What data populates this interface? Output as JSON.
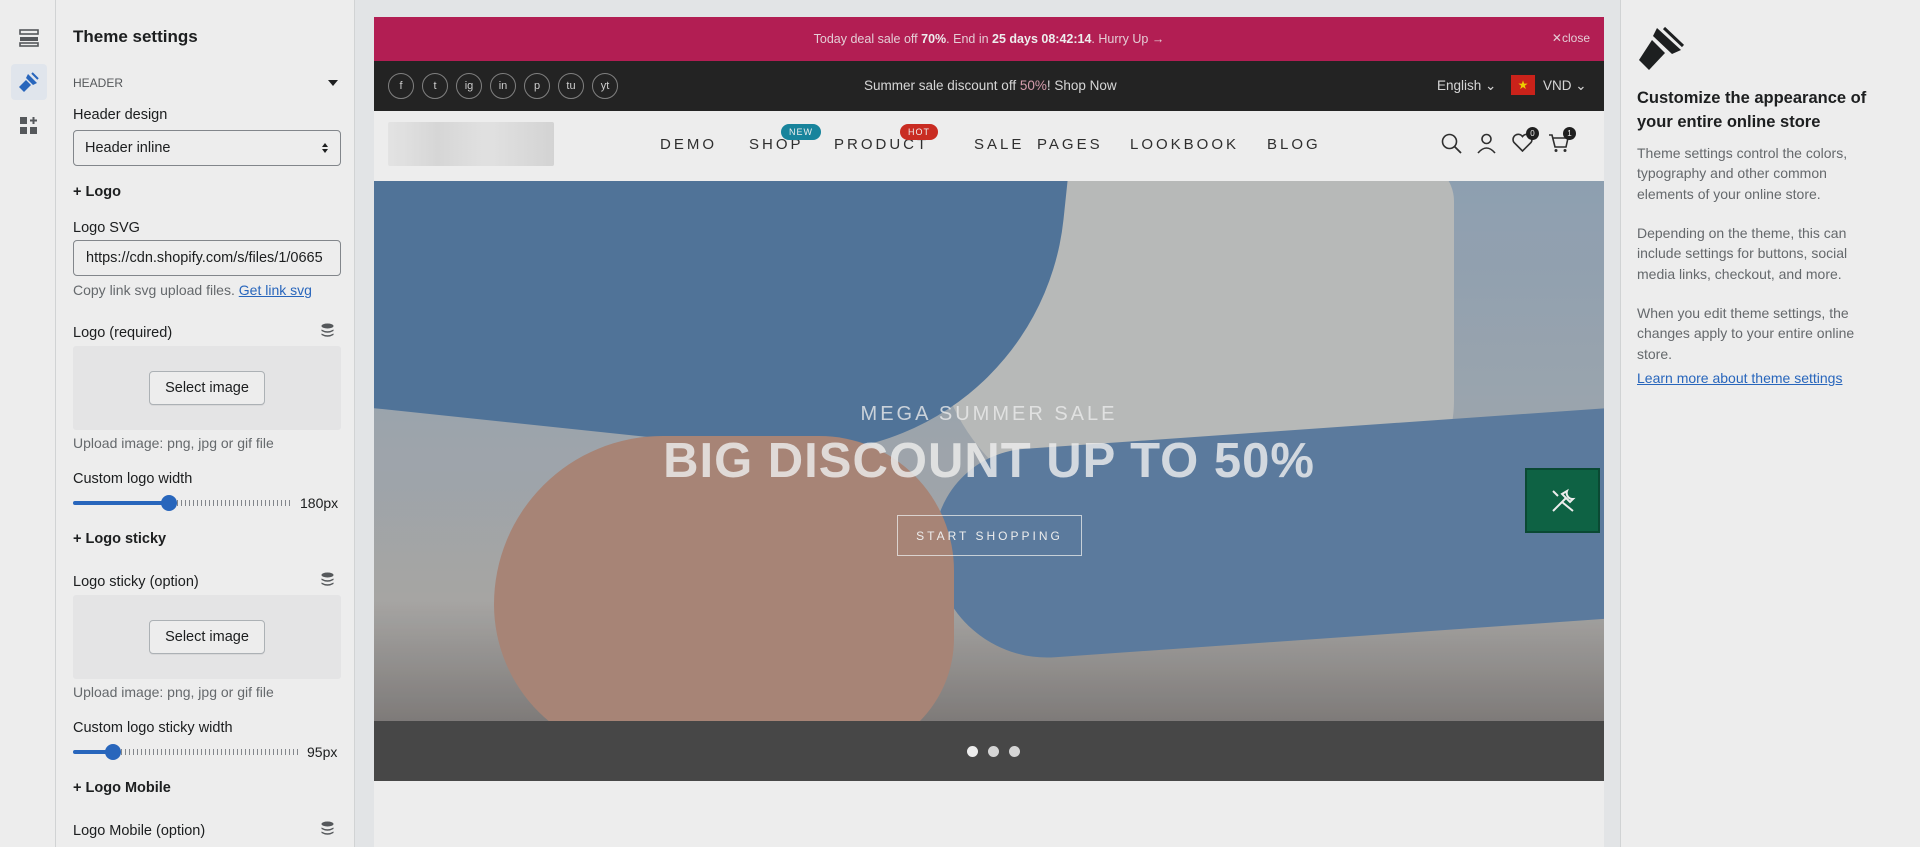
{
  "sidebar": {
    "title": "Theme settings",
    "section": "HEADER",
    "header_design_label": "Header design",
    "header_design_value": "Header inline",
    "logo_group": "+ Logo",
    "logo_svg_label": "Logo SVG",
    "logo_svg_value": "https://cdn.shopify.com/s/files/1/0665",
    "logo_svg_help": "Copy link svg upload files.",
    "logo_svg_help_link": "Get link svg",
    "logo_label": "Logo (required)",
    "select_image": "Select image",
    "upload_help": "Upload image: png, jpg or gif file",
    "logo_width_label": "Custom logo width",
    "logo_width_value": "180px",
    "logo_width_fraction": 0.43,
    "logo_sticky_group": "+ Logo sticky",
    "logo_sticky_label": "Logo sticky (option)",
    "logo_sticky_width_label": "Custom logo sticky width",
    "logo_sticky_width_value": "95px",
    "logo_sticky_width_fraction": 0.17,
    "logo_mobile_group": "+ Logo Mobile",
    "logo_mobile_label": "Logo Mobile (option)"
  },
  "preview": {
    "topbar": {
      "text_pre": "Today deal sale off ",
      "pct": "70%",
      "text_mid": ". End in ",
      "countdown": "25 days 08:42:14",
      "text_post": ". Hurry Up →",
      "close": "close"
    },
    "promo": {
      "pre": "Summer sale discount off ",
      "pct": "50%",
      "post": "! Shop Now"
    },
    "language": "English",
    "currency": "VND",
    "social": [
      "f",
      "t",
      "ig",
      "in",
      "p",
      "tu",
      "yt"
    ],
    "nav": {
      "demo": "DEMO",
      "shop": "SHOP",
      "shop_badge": "NEW",
      "product": "PRODUCT",
      "product_badge": "HOT",
      "sale": "SALE",
      "pages": "PAGES",
      "lookbook": "LOOKBOOK",
      "blog": "BLOG"
    },
    "wishlist_count": "0",
    "cart_count": "1",
    "hero": {
      "subtitle": "MEGA SUMMER SALE",
      "title": "BIG DISCOUNT UP TO 50%",
      "button": "START SHOPPING"
    },
    "colors": {
      "topbar": "#c0215a",
      "new_badge": "#1a8fa8",
      "hot_badge": "#d93025",
      "tool_button": "#106a4a"
    }
  },
  "right_panel": {
    "heading": "Customize the appearance of your entire online store",
    "p1": "Theme settings control the colors, typography and other common elements of your online store.",
    "p2": "Depending on the theme, this can include settings for buttons, social media links, checkout, and more.",
    "p3": "When you edit theme settings, the changes apply to your entire online store.",
    "link": "Learn more about theme settings"
  }
}
